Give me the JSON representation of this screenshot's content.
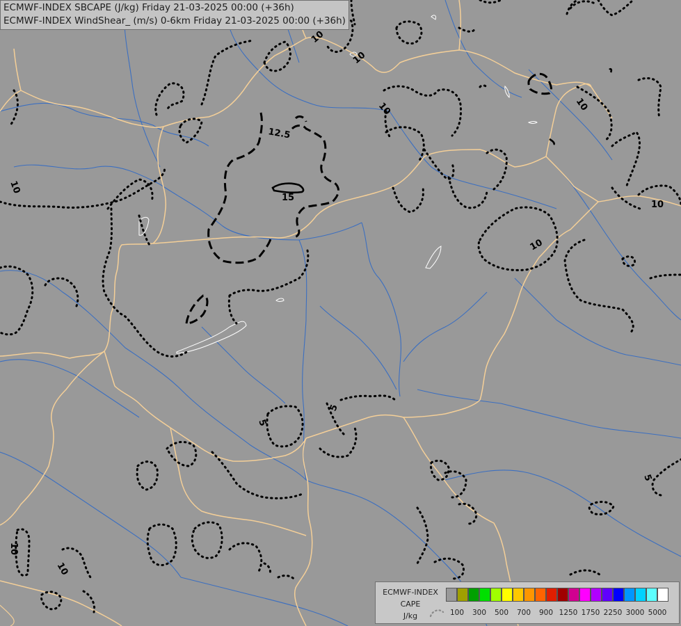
{
  "title_lines": [
    "ECMWF-INDEX SBCAPE (J/kg) Friday 21-03-2025 00:00 (+36h)",
    "ECMWF-INDEX WindShear_ (m/s) 0-6km Friday 21-03-2025 00:00 (+36h)"
  ],
  "contour_labels": [
    "10",
    "10",
    "10",
    "12.5",
    "15",
    "10",
    "10",
    "10",
    "10",
    "5",
    "5",
    "5",
    "10",
    "10"
  ],
  "legend": {
    "line1": "ECMWF-INDEX",
    "line2": "CAPE",
    "line3": "J/kg",
    "colors": [
      "#999999",
      "#a0a000",
      "#00a000",
      "#00e000",
      "#a0ff00",
      "#ffff00",
      "#ffc800",
      "#ff9600",
      "#ff6400",
      "#e01e00",
      "#a00000",
      "#d00090",
      "#ff00ff",
      "#b000ff",
      "#6000ff",
      "#0000ff",
      "#0096ff",
      "#00d2ff",
      "#5effff",
      "#ffffff"
    ],
    "ticks": [
      "100",
      "300",
      "500",
      "700",
      "900",
      "1250",
      "1750",
      "2250",
      "3000",
      "5000"
    ]
  }
}
